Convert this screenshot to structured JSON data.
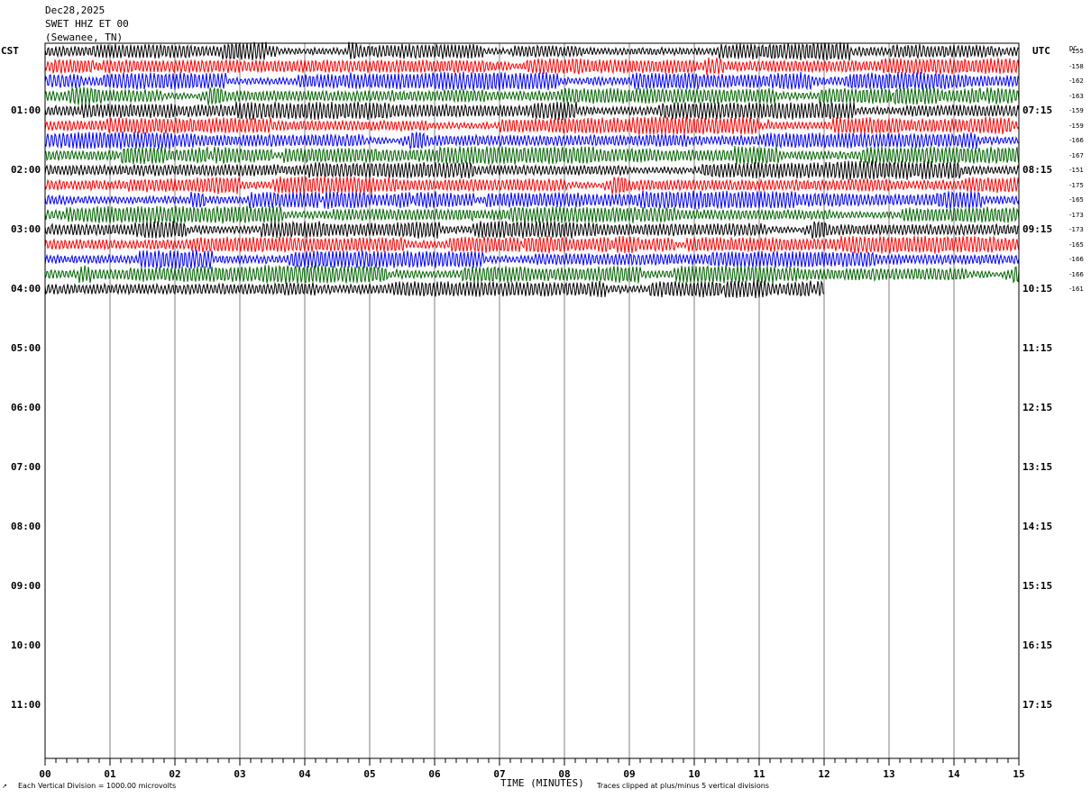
{
  "header": {
    "date": "Dec28,2025",
    "station": "SWET HHZ ET 00",
    "location": "(Sewanee, TN)"
  },
  "left_tz": "CST",
  "right_tz": "UTC",
  "dc_label": "DC",
  "footer": {
    "scale_note": "Each Vertical Division = 1000.00 microvolts",
    "xlabel": "TIME (MINUTES)",
    "clip_note": "Traces clipped at plus/minus 5 vertical divisions",
    "corner_mark": "↗"
  },
  "colors": {
    "trace_cycle": [
      "#000000",
      "#ff0000",
      "#0000ff",
      "#006400"
    ],
    "grid": "#808080",
    "frame": "#000000"
  },
  "chart_data": {
    "type": "line",
    "title": "SWET HHZ ET 00",
    "xlabel": "TIME (MINUTES)",
    "xlim": [
      0,
      15
    ],
    "x_ticks": [
      "00",
      "01",
      "02",
      "03",
      "04",
      "05",
      "06",
      "07",
      "08",
      "09",
      "10",
      "11",
      "12",
      "13",
      "14",
      "15"
    ],
    "left_hour_labels": [
      "01:00",
      "02:00",
      "03:00",
      "04:00",
      "05:00",
      "06:00",
      "07:00",
      "08:00",
      "09:00",
      "10:00",
      "11:00"
    ],
    "right_hour_labels": [
      "07:15",
      "08:15",
      "09:15",
      "10:15",
      "11:15",
      "12:15",
      "13:15",
      "14:15",
      "15:15",
      "16:15",
      "17:15"
    ],
    "dc_offsets": [
      "-155",
      "-158",
      "-162",
      "-163",
      "-159",
      "-159",
      "-166",
      "-167",
      "-151",
      "-175",
      "-165",
      "-173",
      "-173",
      "-165",
      "-166",
      "-166",
      "-161"
    ],
    "traces_recorded": 17,
    "trace_end_minutes": [
      15,
      15,
      15,
      15,
      15,
      15,
      15,
      15,
      15,
      15,
      15,
      15,
      15,
      15,
      15,
      15,
      12
    ],
    "note": "Last trace (04:00 CST) ends at ~12 minutes"
  }
}
